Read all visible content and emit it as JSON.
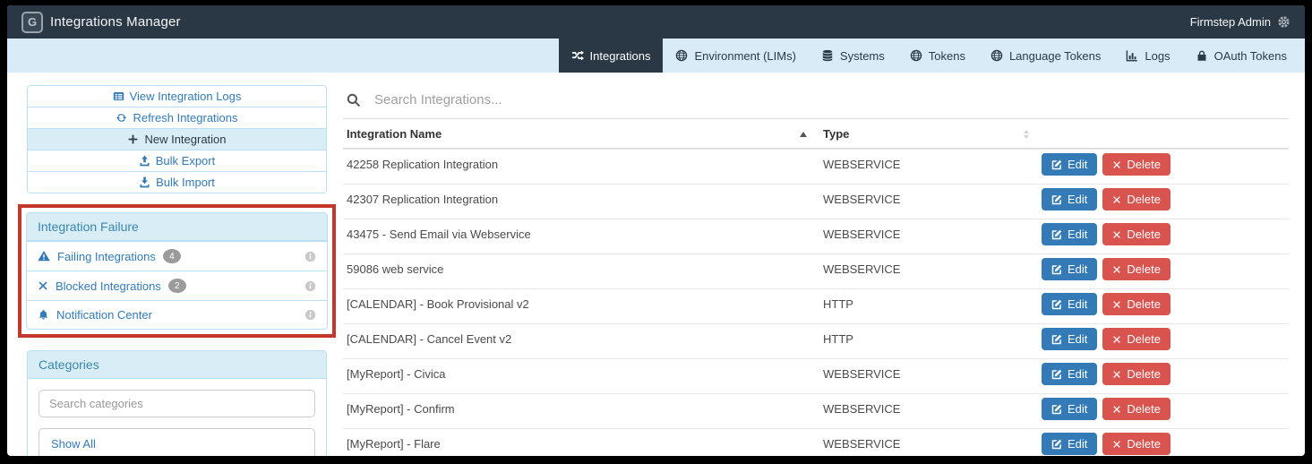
{
  "app": {
    "title": "Integrations Manager",
    "user_label": "Firmstep Admin",
    "logo_letter": "G"
  },
  "nav": {
    "tabs": [
      {
        "label": "Integrations",
        "icon": "shuffle-icon",
        "active": true
      },
      {
        "label": "Environment (LIMs)",
        "icon": "globe-icon",
        "active": false
      },
      {
        "label": "Systems",
        "icon": "database-icon",
        "active": false
      },
      {
        "label": "Tokens",
        "icon": "globe-icon",
        "active": false
      },
      {
        "label": "Language Tokens",
        "icon": "globe-icon",
        "active": false
      },
      {
        "label": "Logs",
        "icon": "bar-chart-icon",
        "active": false
      },
      {
        "label": "OAuth Tokens",
        "icon": "lock-icon",
        "active": false
      }
    ]
  },
  "sidebar": {
    "actions": [
      {
        "label": "View Integration Logs",
        "icon": "table-icon",
        "active": false
      },
      {
        "label": "Refresh Integrations",
        "icon": "refresh-icon",
        "active": false
      },
      {
        "label": "New Integration",
        "icon": "plus-icon",
        "active": true
      },
      {
        "label": "Bulk Export",
        "icon": "upload-icon",
        "active": false
      },
      {
        "label": "Bulk Import",
        "icon": "download-icon",
        "active": false
      }
    ],
    "failure_panel": {
      "title": "Integration Failure",
      "items": [
        {
          "label": "Failing Integrations",
          "icon": "warning-icon",
          "badge": "4"
        },
        {
          "label": "Blocked Integrations",
          "icon": "x-icon",
          "badge": "2"
        },
        {
          "label": "Notification Center",
          "icon": "bell-icon",
          "badge": ""
        }
      ]
    },
    "categories_panel": {
      "title": "Categories",
      "search_placeholder": "Search categories",
      "show_all_label": "Show All"
    }
  },
  "main": {
    "search_placeholder": "Search Integrations...",
    "table": {
      "columns": [
        {
          "label": "Integration Name",
          "sort": "asc"
        },
        {
          "label": "Type",
          "sort": "unsorted"
        }
      ],
      "edit_label": "Edit",
      "delete_label": "Delete",
      "rows": [
        {
          "name": "42258 Replication Integration",
          "type": "WEBSERVICE"
        },
        {
          "name": "42307 Replication Integration",
          "type": "WEBSERVICE"
        },
        {
          "name": "43475 - Send Email via Webservice",
          "type": "WEBSERVICE"
        },
        {
          "name": "59086 web service",
          "type": "WEBSERVICE"
        },
        {
          "name": "[CALENDAR] - Book Provisional v2",
          "type": "HTTP"
        },
        {
          "name": "[CALENDAR] - Cancel Event v2",
          "type": "HTTP"
        },
        {
          "name": "[MyReport] - Civica",
          "type": "WEBSERVICE"
        },
        {
          "name": "[MyReport] - Confirm",
          "type": "WEBSERVICE"
        },
        {
          "name": "[MyReport] - Flare",
          "type": "WEBSERVICE"
        }
      ]
    }
  },
  "colors": {
    "accent": "#337ab7",
    "danger": "#d9534f",
    "navbar": "#2a3845",
    "band": "#d8ebf6",
    "panel_border": "#b9dff0",
    "panel_header_bg": "#d9edf7",
    "panel_header_text": "#3a87ad",
    "highlight_red": "#c4372d"
  }
}
